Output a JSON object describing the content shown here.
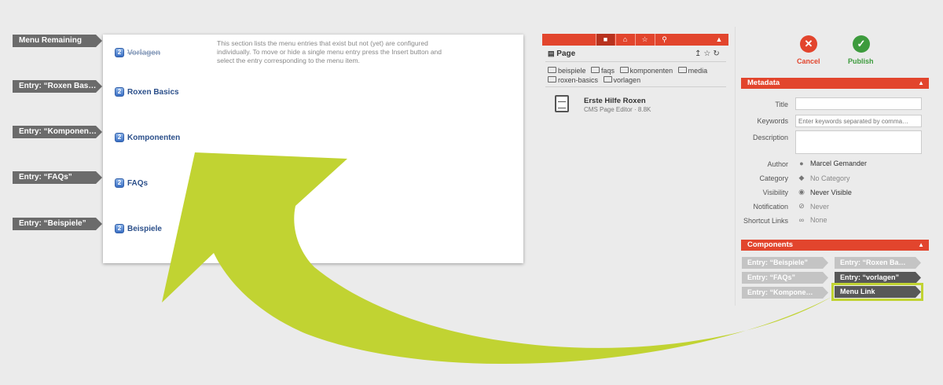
{
  "left_tags": [
    "Menu Remaining",
    "Entry: “Roxen Bas…",
    "Entry: “Komponen…",
    "Entry: “FAQs”",
    "Entry: “Beispiele”"
  ],
  "card": {
    "entries": [
      "Vorlagen",
      "Roxen Basics",
      "Komponenten",
      "FAQs",
      "Beispiele"
    ],
    "description": "This section lists the menu entries that exist but not (yet) are configured individually. To move or hide a single menu entry press the Insert button and select the entry corresponding to the menu item."
  },
  "middle": {
    "title": "Page",
    "folders": [
      "beispiele",
      "faqs",
      "komponenten",
      "media",
      "roxen-basics",
      "vorlagen"
    ],
    "file_title": "Erste Hilfe Roxen",
    "file_sub": "CMS Page Editor · 8.8K"
  },
  "right": {
    "cancel_label": "Cancel",
    "publish_label": "Publish",
    "metadata_title": "Metadata",
    "fields": {
      "title_label": "Title",
      "keywords_label": "Keywords",
      "keywords_placeholder": "Enter keywords separated by comma…",
      "description_label": "Description",
      "author_label": "Author",
      "author_value": "Marcel Gemander",
      "category_label": "Category",
      "category_value": "No Category",
      "visibility_label": "Visibility",
      "visibility_value": "Never Visible",
      "notification_label": "Notification",
      "notification_value": "Never",
      "shortcut_label": "Shortcut Links",
      "shortcut_value": "None"
    },
    "components_title": "Components",
    "components": [
      "Entry: “Beispiele”",
      "Entry: “Roxen Ba…",
      "Entry: “FAQs”",
      "Entry: “vorlagen”",
      "Entry: “Kompone…",
      "Menu Link"
    ]
  },
  "colors": {
    "accent": "#e2452d",
    "arrow": "#c1d332",
    "cancel": "#e2452d",
    "publish": "#3d9b3d"
  }
}
